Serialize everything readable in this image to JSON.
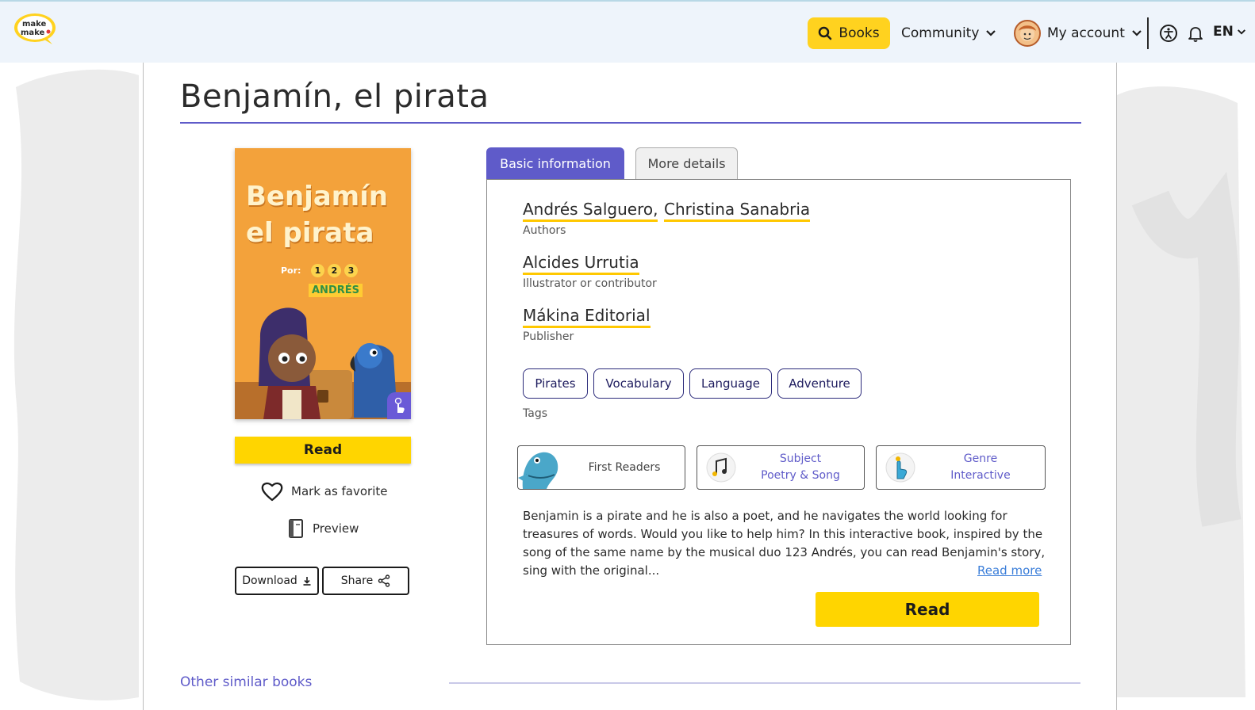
{
  "header": {
    "logo_text": "make make",
    "books_label": "Books",
    "community_label": "Community",
    "account_label": "My account",
    "language_label": "EN"
  },
  "book": {
    "title": "Benjamín, el pirata",
    "cover": {
      "title_line1": "Benjamín",
      "title_line2": "el pirata",
      "por_label": "Por:",
      "num1": "1",
      "num2": "2",
      "num3": "3",
      "author_name": "ANDRÉS"
    },
    "read_label": "Read",
    "favorite_label": "Mark as favorite",
    "preview_label": "Preview",
    "download_label": "Download",
    "share_label": "Share"
  },
  "tabs": {
    "basic": "Basic information",
    "more": "More details"
  },
  "info": {
    "author1": "Andrés Salguero,",
    "author2": "Christina Sanabria",
    "authors_role": "Authors",
    "illustrator": "Alcides Urrutia",
    "illustrator_role": "Illustrator or contributor",
    "publisher": "Mákina Editorial",
    "publisher_role": "Publisher",
    "tags": [
      "Pirates",
      "Vocabulary",
      "Language",
      "Adventure"
    ],
    "tags_label": "Tags",
    "level": "First Readers",
    "subject_label": "Subject",
    "subject_value": "Poetry & Song",
    "genre_label": "Genre",
    "genre_value": "Interactive",
    "description": "Benjamin is a pirate and he is also a poet, and he navigates the world looking for treasures of words. Would you like to help him? In this interactive book, inspired by the song of the same name by the musical duo 123 Andrés, you can read Benjamin's story, sing with the original...",
    "read_more_label": "Read more",
    "read_label": "Read"
  },
  "similar": {
    "heading": "Other similar books"
  },
  "colors": {
    "accent": "#5f5bc9",
    "yellow": "#ffd500",
    "header_bg": "#eef4fb"
  }
}
